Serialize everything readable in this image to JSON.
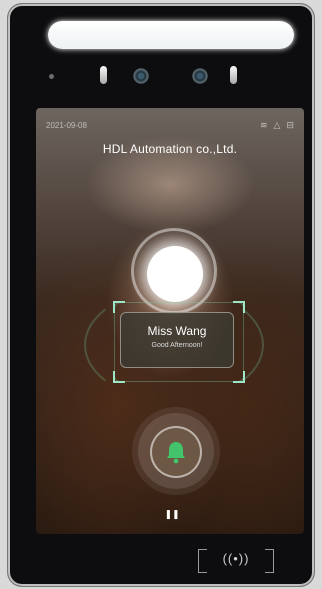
{
  "device": {
    "colors": {
      "bezel": "#0d0d0f",
      "accent": "#9ee6c8",
      "notice": "#e46a5a"
    }
  },
  "status_bar": {
    "date": "2021-09-08",
    "icons": [
      "wifi-icon",
      "alert-icon",
      "network-icon"
    ]
  },
  "header": {
    "company": "HDL Automation co.,Ltd."
  },
  "recognition": {
    "name": "Miss Wang",
    "greeting": "Good Afternoon!"
  },
  "controls": {
    "bell_icon": "bell-icon",
    "pause_icon": "pause-icon",
    "nfc_icon": "nfc-icon"
  }
}
